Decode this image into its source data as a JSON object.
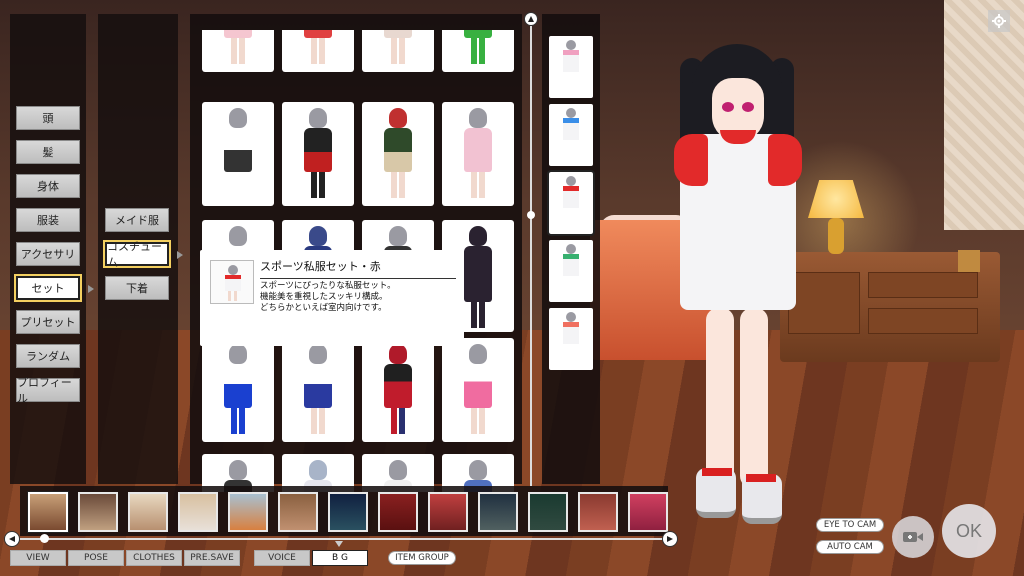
{
  "left_menu": {
    "items": [
      {
        "label": "頭"
      },
      {
        "label": "髪"
      },
      {
        "label": "身体"
      },
      {
        "label": "服装"
      },
      {
        "label": "アクセサリ"
      },
      {
        "label": "セット"
      },
      {
        "label": "プリセット"
      },
      {
        "label": "ランダム"
      },
      {
        "label": "プロフィール"
      }
    ],
    "selected": "セット"
  },
  "sub_menu": {
    "items": [
      {
        "label": "メイド服"
      },
      {
        "label": "コスチューム"
      },
      {
        "label": "下着"
      }
    ],
    "selected": "コスチューム"
  },
  "tooltip": {
    "title": "スポーツ私服セット・赤",
    "description": "スポーツにぴったりな私服セット。\n機能美を重視したスッキリ構成。\nどちらかといえば室内向けです。"
  },
  "bottom_tabs": [
    {
      "label": "VIEW"
    },
    {
      "label": "POSE"
    },
    {
      "label": "CLOTHES"
    },
    {
      "label": "PRE.SAVE"
    },
    {
      "label": "VOICE"
    },
    {
      "label": "B G"
    }
  ],
  "selected_tab": "B G",
  "item_group_label": "ITEM GROUP",
  "camera": {
    "eye_to_cam": "EYE TO CAM",
    "auto_cam": "AUTO CAM"
  },
  "ok_label": "OK",
  "colors": {
    "panel_bg": "#140e0e",
    "shirt_red": "#e22a2a",
    "highlight": "#f4d060"
  }
}
